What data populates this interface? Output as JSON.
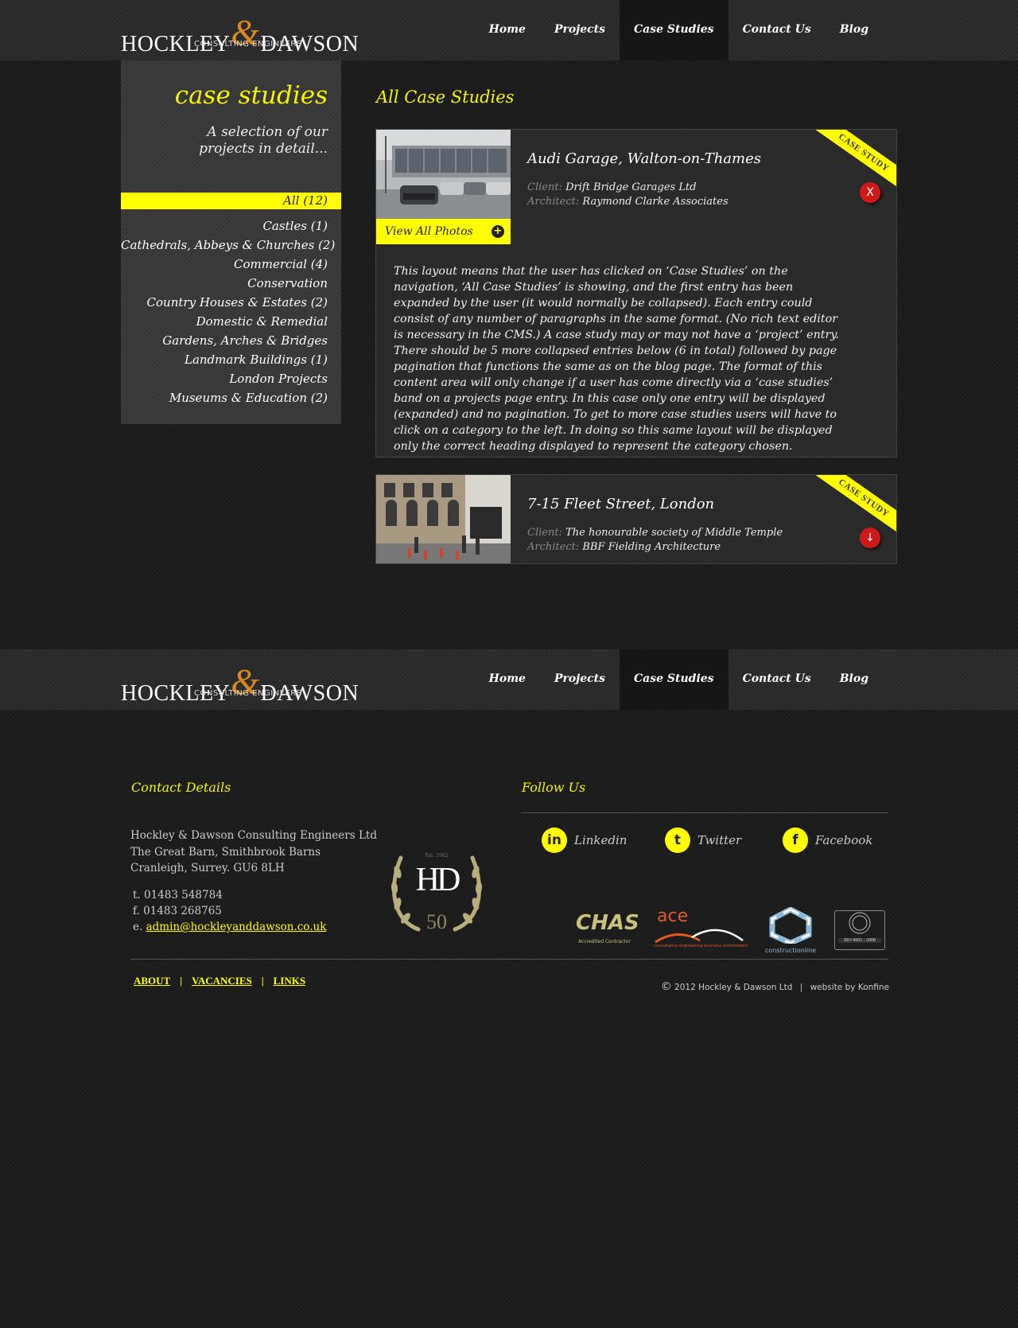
{
  "brand": {
    "name_left": "HOCKLEY",
    "ampersand": "&",
    "name_right": "DAWSON",
    "tagline": "CONSULTING ENGINEERS"
  },
  "nav": [
    "Home",
    "Projects",
    "Case Studies",
    "Contact Us",
    "Blog"
  ],
  "nav_active": "Case Studies",
  "sidebar": {
    "title": "case studies",
    "intro_line1": "A selection of our",
    "intro_line2": "projects in detail...",
    "categories": [
      "All (12)",
      "Castles (1)",
      "Cathedrals, Abbeys & Churches (2)",
      "Commercial (4)",
      "Conservation",
      "Country Houses & Estates (2)",
      "Domestic & Remedial",
      "Gardens, Arches & Bridges",
      "Landmark Buildings (1)",
      "London Projects",
      "Museums & Education (2)"
    ]
  },
  "main": {
    "title": "All Case Studies",
    "ribbon": "CASE STUDY",
    "client_label": "Client:",
    "architect_label": "Architect:",
    "view_photos": "View All Photos",
    "entries": [
      {
        "title": "Audi Garage, Walton-on-Thames",
        "client": "Drift Bridge Garages Ltd",
        "architect": "Raymond Clarke Associates",
        "action": "X",
        "body": "This layout means that the user has clicked on ‘Case Studies’ on the navigation, ‘All Case Studies’ is showing, and the first entry has been expanded by the user (it would normally be collapsed). Each entry could consist of any number of paragraphs in the same format. (No rich text editor is necessary in the CMS.) A case study may or may not have a  ‘project’ entry. There should be 5 more collapsed entries below (6 in total) followed by page pagination that functions the same as on the blog page. The format of this content area will only change if a user has come directly via a ‘case studies’ band on a projects page entry. In this case only one entry will be displayed (expanded) and no pagination. To get to more case studies users will have to click on a category to the left. In doing so this same layout will be displayed only the correct heading displayed to represent the category chosen."
      },
      {
        "title": "7-15 Fleet Street, London",
        "client": "The honourable society of Middle Temple",
        "architect": "BBF Fielding Architecture",
        "action": "↓"
      }
    ]
  },
  "footer": {
    "contact_title": "Contact Details",
    "follow_title": "Follow Us",
    "address": [
      "Hockley & Dawson Consulting Engineers Ltd",
      "The Great Barn, Smithbrook Barns",
      "Cranleigh, Surrey. GU6 8LH"
    ],
    "tel": "t. 01483 548784",
    "fax": "f. 01483 268765",
    "email_prefix": "e.",
    "email": "admin@hockleyanddawson.co.uk",
    "seal": {
      "monogram": "HD",
      "est": "Est. 1962",
      "years": "50"
    },
    "social": [
      {
        "label": "Linkedin",
        "icon": "in"
      },
      {
        "label": "Twitter",
        "icon": "t"
      },
      {
        "label": "Facebook",
        "icon": "f"
      }
    ],
    "accreditations": {
      "chas": "CHAS",
      "chas_sub": "Accredited Contractor",
      "ace": "ace",
      "ace_sub": "consultancy engineering business environment",
      "constructionline": "constructionline",
      "iso": "ISO 9001 : 2008"
    },
    "links": [
      "ABOUT",
      "VACANCIES",
      "LINKS"
    ],
    "link_sep": "|",
    "copyright_symbol": "©",
    "copyright": "2012 Hockley & Dawson Ltd",
    "credit": "website by Konfine",
    "credit_sep": "|"
  },
  "colors": {
    "accent": "#ffff00",
    "amp": "#d98a1f",
    "action": "#d01818",
    "bg": "#1b1b1b"
  }
}
